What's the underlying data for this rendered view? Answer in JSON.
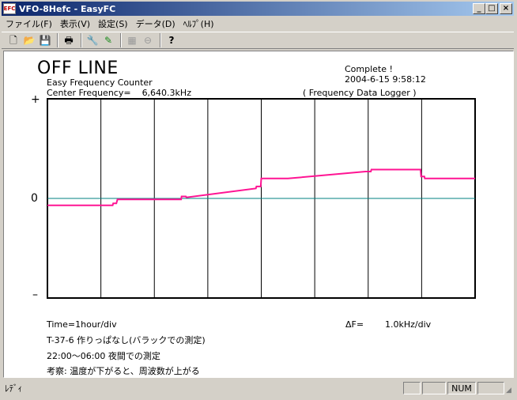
{
  "window": {
    "app_icon": "EFC",
    "title": "VFO-8Hefc - EasyFC",
    "minimize_glyph": "_",
    "maximize_glyph": "□",
    "close_glyph": "×"
  },
  "menu": [
    {
      "label": "ファイル(F)"
    },
    {
      "label": "表示(V)"
    },
    {
      "label": "設定(S)"
    },
    {
      "label": "データ(D)"
    },
    {
      "label": "ﾍﾙﾌﾟ(H)"
    }
  ],
  "toolbar": {
    "icons": {
      "new": "new-document-icon",
      "open": "open-folder-icon",
      "save": "save-disk-icon",
      "print": "printer-icon",
      "settings": "wrench-icon",
      "edit": "marker-pen-icon",
      "grid": "grid-icon",
      "stop": "stop-circle-icon",
      "help": "help-question-icon"
    },
    "glyphs": {
      "new": "🗋",
      "open": "📂",
      "save": "💾",
      "print": "🖶",
      "settings": "🔧",
      "edit": "✎",
      "grid": "▦",
      "stop": "⊖",
      "help": "?"
    }
  },
  "header": {
    "status": "OFF LINE",
    "app_name": "Easy Frequency Counter",
    "center_freq_label": "Center Frequency=",
    "center_freq_value": "6,640.3kHz",
    "complete": "Complete !",
    "datetime": "2004-6-15  9:58:12",
    "logger": "( Frequency Data Logger )"
  },
  "y_axis": {
    "plus": "+",
    "zero": "0",
    "minus": "–"
  },
  "footer": {
    "time_div": "Time=1hour/div",
    "delta_f_label": "ΔF=",
    "delta_f_value": "1.0kHz/div",
    "note1": "T-37-6 作りっぱなし(バラックでの測定)",
    "note2": "22:00〜06:00 夜間での測定",
    "note3": "考察: 温度が下がると、周波数が上がる"
  },
  "statusbar": {
    "text": "ﾚﾃﾞｨ",
    "num": "NUM"
  },
  "colors": {
    "trace": "#ff1493",
    "grid": "#000000",
    "zero_line": "#008080",
    "titlebar_start": "#0a246a",
    "titlebar_end": "#a6caf0"
  },
  "chart_data": {
    "type": "line",
    "title": "",
    "xlabel": "",
    "ylabel": "",
    "xlim": [
      0,
      8
    ],
    "ylim": [
      -1,
      1
    ],
    "x_divisions": 8,
    "y_divisions": 2,
    "grid": true,
    "series": [
      {
        "color": "#ff1493",
        "points": [
          [
            0.0,
            -0.07
          ],
          [
            1.22,
            -0.07
          ],
          [
            1.23,
            -0.05
          ],
          [
            1.29,
            -0.05
          ],
          [
            1.3,
            -0.03
          ],
          [
            1.31,
            -0.01
          ],
          [
            2.5,
            -0.01
          ],
          [
            2.51,
            0.02
          ],
          [
            2.59,
            0.02
          ],
          [
            2.6,
            0.01
          ],
          [
            3.9,
            0.1
          ],
          [
            3.91,
            0.12
          ],
          [
            3.99,
            0.12
          ],
          [
            4.0,
            0.2
          ],
          [
            4.5,
            0.2
          ],
          [
            5.95,
            0.27
          ],
          [
            6.05,
            0.27
          ],
          [
            6.06,
            0.29
          ],
          [
            6.98,
            0.29
          ],
          [
            6.99,
            0.22
          ],
          [
            7.05,
            0.22
          ],
          [
            7.06,
            0.2
          ],
          [
            8.0,
            0.2
          ]
        ]
      }
    ]
  }
}
